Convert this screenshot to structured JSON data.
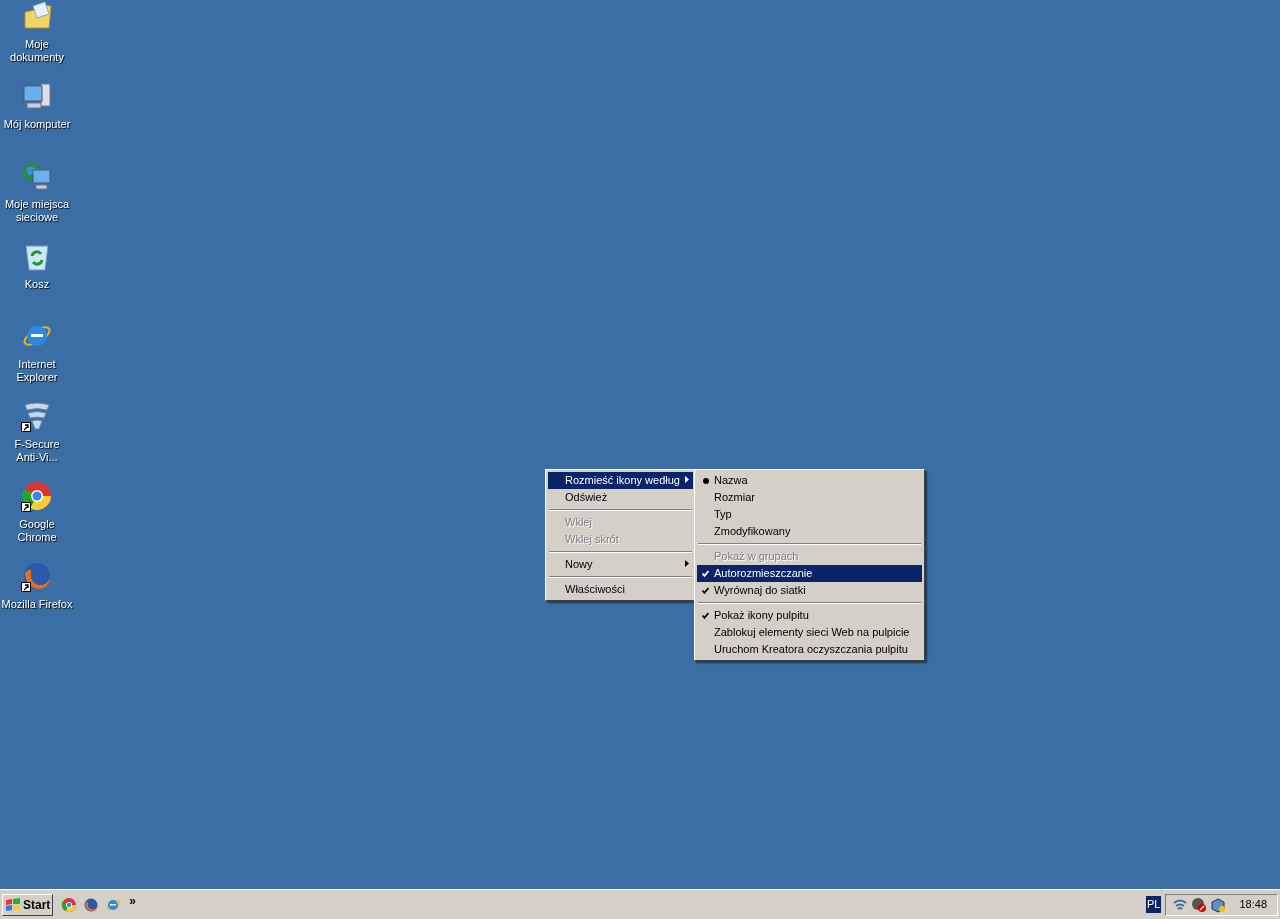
{
  "desktop_icons": [
    {
      "label": "Moje dokumenty",
      "kind": "documents",
      "shortcut": false
    },
    {
      "label": "Mój komputer",
      "kind": "computer",
      "shortcut": false
    },
    {
      "label": "Moje miejsca sieciowe",
      "kind": "network",
      "shortcut": false
    },
    {
      "label": "Kosz",
      "kind": "recycle",
      "shortcut": false
    },
    {
      "label": "Internet Explorer",
      "kind": "ie",
      "shortcut": false
    },
    {
      "label": "F-Secure Anti-Vi...",
      "kind": "fsecure",
      "shortcut": true
    },
    {
      "label": "Google Chrome",
      "kind": "chrome",
      "shortcut": true
    },
    {
      "label": "Mozilla Firefox",
      "kind": "firefox",
      "shortcut": true
    }
  ],
  "context_menu": {
    "items": [
      {
        "kind": "item",
        "label": "Rozmieść ikony według",
        "submenu": true,
        "disabled": false,
        "selected": true
      },
      {
        "kind": "item",
        "label": "Odśwież",
        "submenu": false,
        "disabled": false,
        "selected": false
      },
      {
        "kind": "separator"
      },
      {
        "kind": "item",
        "label": "Wklej",
        "submenu": false,
        "disabled": true,
        "selected": false
      },
      {
        "kind": "item",
        "label": "Wklej skrót",
        "submenu": false,
        "disabled": true,
        "selected": false
      },
      {
        "kind": "separator"
      },
      {
        "kind": "item",
        "label": "Nowy",
        "submenu": true,
        "disabled": false,
        "selected": false
      },
      {
        "kind": "separator"
      },
      {
        "kind": "item",
        "label": "Właściwości",
        "submenu": false,
        "disabled": false,
        "selected": false
      }
    ]
  },
  "submenu": {
    "items": [
      {
        "kind": "radio",
        "label": "Nazwa",
        "checked": true,
        "disabled": false,
        "selected": false
      },
      {
        "kind": "radio",
        "label": "Rozmiar",
        "checked": false,
        "disabled": false,
        "selected": false
      },
      {
        "kind": "radio",
        "label": "Typ",
        "checked": false,
        "disabled": false,
        "selected": false
      },
      {
        "kind": "radio",
        "label": "Zmodyfikowany",
        "checked": false,
        "disabled": false,
        "selected": false
      },
      {
        "kind": "separator"
      },
      {
        "kind": "check",
        "label": "Pokaż w grupach",
        "checked": false,
        "disabled": true,
        "selected": false
      },
      {
        "kind": "check",
        "label": "Autorozmieszczanie",
        "checked": true,
        "disabled": false,
        "selected": true
      },
      {
        "kind": "check",
        "label": "Wyrównaj do siatki",
        "checked": true,
        "disabled": false,
        "selected": false
      },
      {
        "kind": "separator"
      },
      {
        "kind": "check",
        "label": "Pokaż ikony pulpitu",
        "checked": true,
        "disabled": false,
        "selected": false
      },
      {
        "kind": "check",
        "label": "Zablokuj elementy sieci Web na pulpicie",
        "checked": false,
        "disabled": false,
        "selected": false
      },
      {
        "kind": "check",
        "label": "Uruchom Kreatora oczyszczania pulpitu",
        "checked": false,
        "disabled": false,
        "selected": false
      }
    ]
  },
  "taskbar": {
    "start_label": "Start",
    "quick_launch": [
      {
        "kind": "chrome"
      },
      {
        "kind": "firefox"
      },
      {
        "kind": "ie"
      }
    ],
    "overflow": "»",
    "language": "PL",
    "clock": "18:48"
  }
}
